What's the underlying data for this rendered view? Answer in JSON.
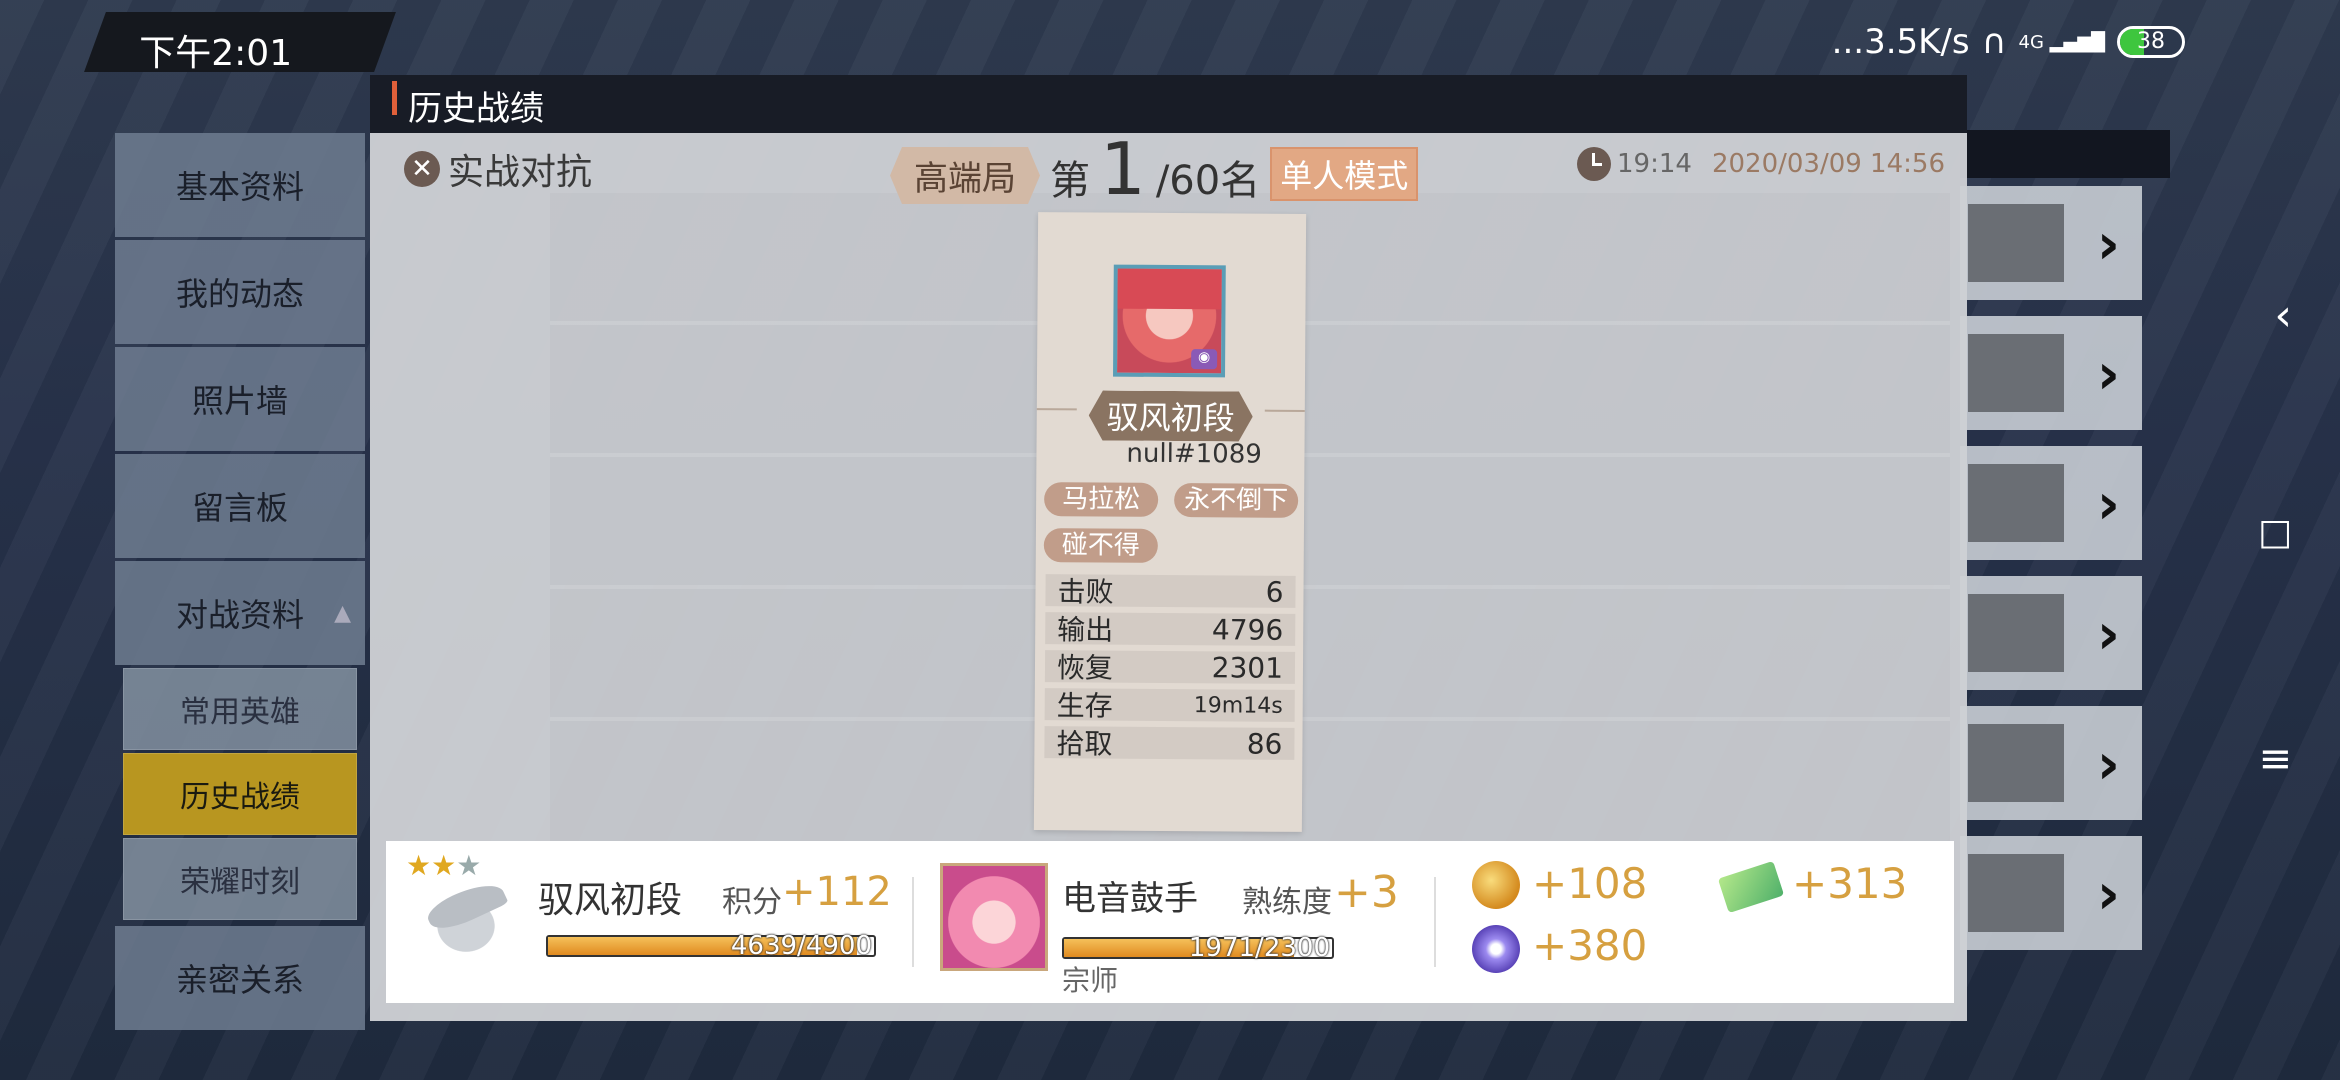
{
  "status_bar": {
    "time": "下午2:01",
    "network_speed": "...3.5K/s",
    "signal": "4G",
    "battery": "38"
  },
  "sidebar": {
    "items": [
      {
        "label": "基本资料"
      },
      {
        "label": "我的动态"
      },
      {
        "label": "照片墙"
      },
      {
        "label": "留言板"
      },
      {
        "label": "对战资料"
      }
    ],
    "sub_items": [
      {
        "label": "常用英雄",
        "active": false
      },
      {
        "label": "历史战绩",
        "active": true
      },
      {
        "label": "荣耀时刻",
        "active": false
      }
    ],
    "last_item": {
      "label": "亲密关系"
    }
  },
  "modal": {
    "title": "历史战绩",
    "mode_name": "实战对抗",
    "tier_tag": "高端局",
    "rank_prefix": "第",
    "rank": "1",
    "rank_total": "/60名",
    "mode_tag": "单人模式",
    "duration": "19:14",
    "datetime": "2020/03/09 14:56",
    "player": {
      "rank_title": "驭风初段",
      "id": "null#1089",
      "badges": [
        "马拉松",
        "永不倒下",
        "碰不得"
      ],
      "stats": [
        {
          "label": "击败",
          "value": "6"
        },
        {
          "label": "输出",
          "value": "4796"
        },
        {
          "label": "恢复",
          "value": "2301"
        },
        {
          "label": "生存",
          "value": "19m14s"
        },
        {
          "label": "拾取",
          "value": "86"
        }
      ]
    },
    "rewards": {
      "rank_name": "驭风初段",
      "score_label": "积分",
      "score_delta": "+112",
      "score_progress_text": "4639/4900",
      "score_progress": 0.947,
      "hero_name": "电音鼓手",
      "proficiency_label": "熟练度",
      "proficiency_delta": "+3",
      "hero_progress_text": "1971/2300",
      "hero_progress": 0.857,
      "hero_level": "宗师",
      "gold": "+108",
      "gem": "+313",
      "orb": "+380"
    }
  },
  "colors": {
    "accent_gold": "#d6a040",
    "active_tab": "#b89620",
    "title_mark": "#e0603a"
  }
}
